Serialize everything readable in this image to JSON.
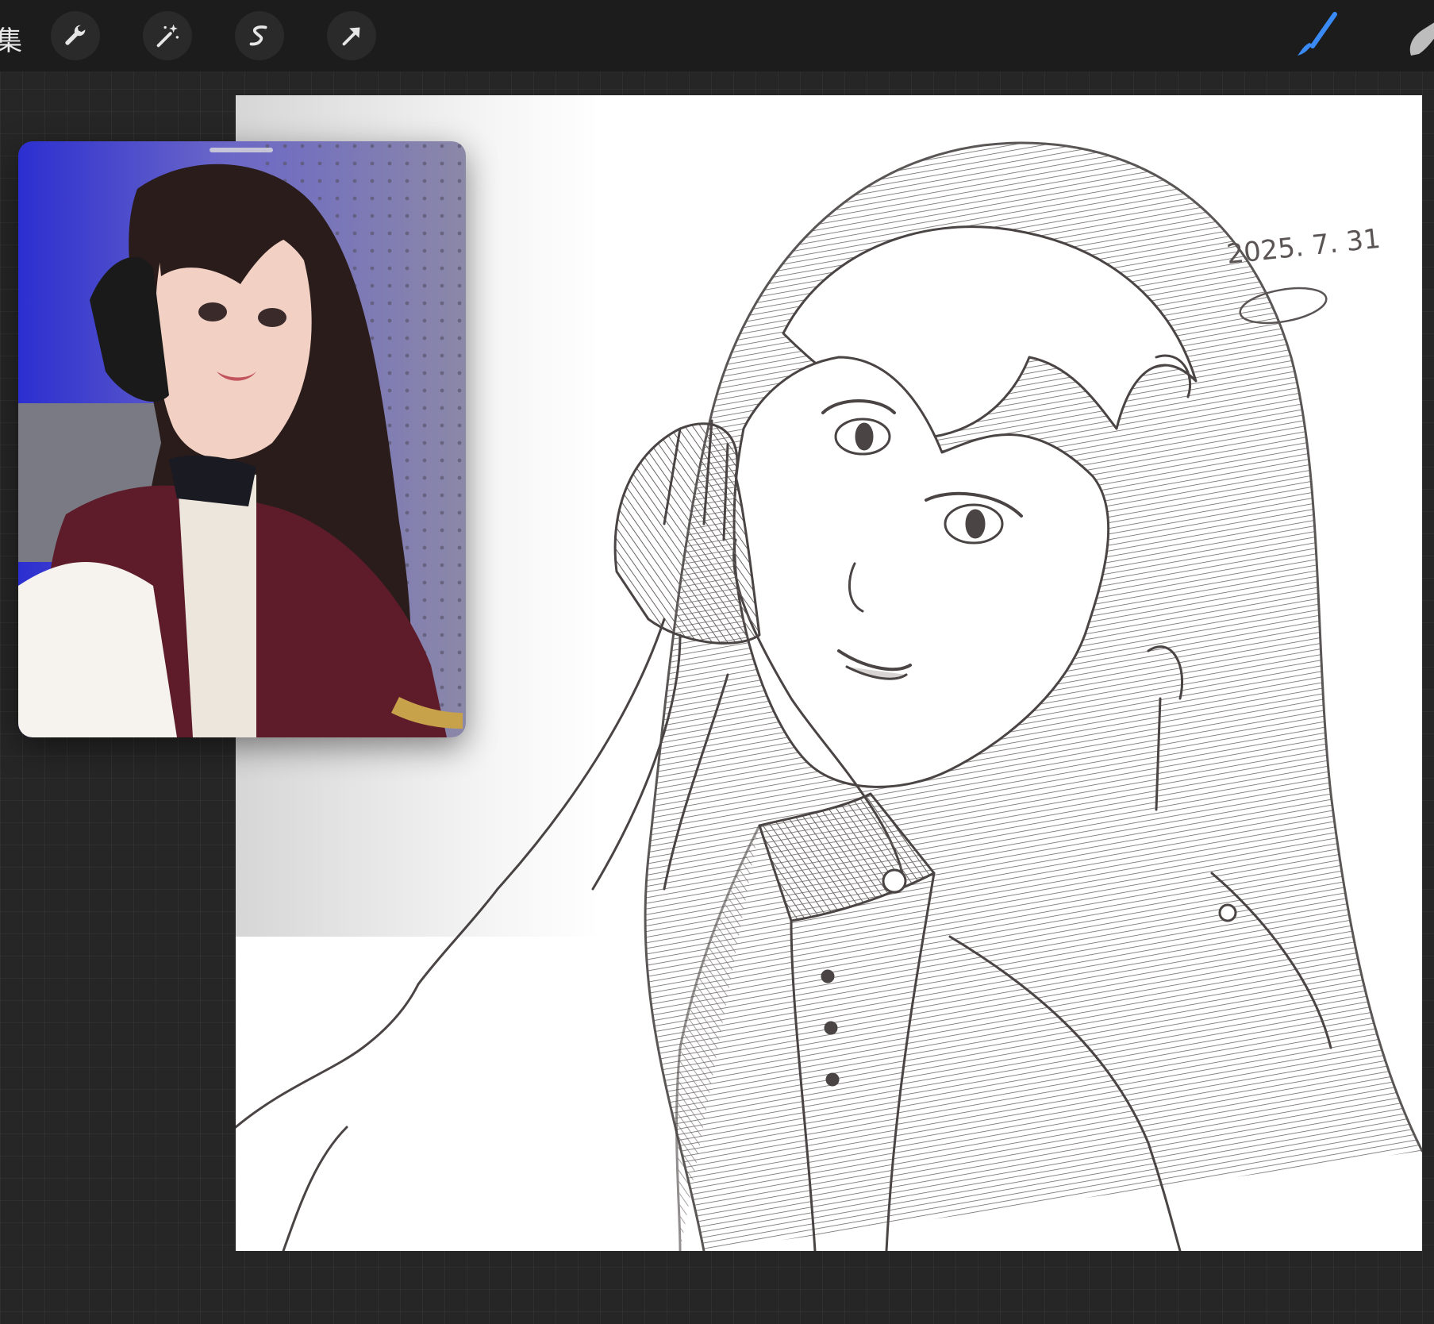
{
  "toolbar": {
    "gallery_label_fragment": "集",
    "tools": [
      {
        "name": "actions",
        "icon": "wrench-icon"
      },
      {
        "name": "adjustments",
        "icon": "magic-wand-icon"
      },
      {
        "name": "selection",
        "icon": "selection-s-icon"
      },
      {
        "name": "transform",
        "icon": "arrow-cursor-icon"
      }
    ],
    "right_tools": [
      {
        "name": "brush",
        "icon": "brush-icon",
        "active": true,
        "color": "#3a8af5"
      },
      {
        "name": "smudge",
        "icon": "smudge-finger-icon",
        "active": false,
        "color": "#bdbdbd"
      }
    ]
  },
  "canvas": {
    "signature_date": "2025. 7. 31",
    "background": "#ffffff",
    "stroke_color": "#4a4444"
  },
  "reference_window": {
    "type": "photo reference"
  },
  "colors": {
    "app_background": "#262626",
    "toolbar_background": "#1c1c1c",
    "accent": "#3a8af5"
  }
}
